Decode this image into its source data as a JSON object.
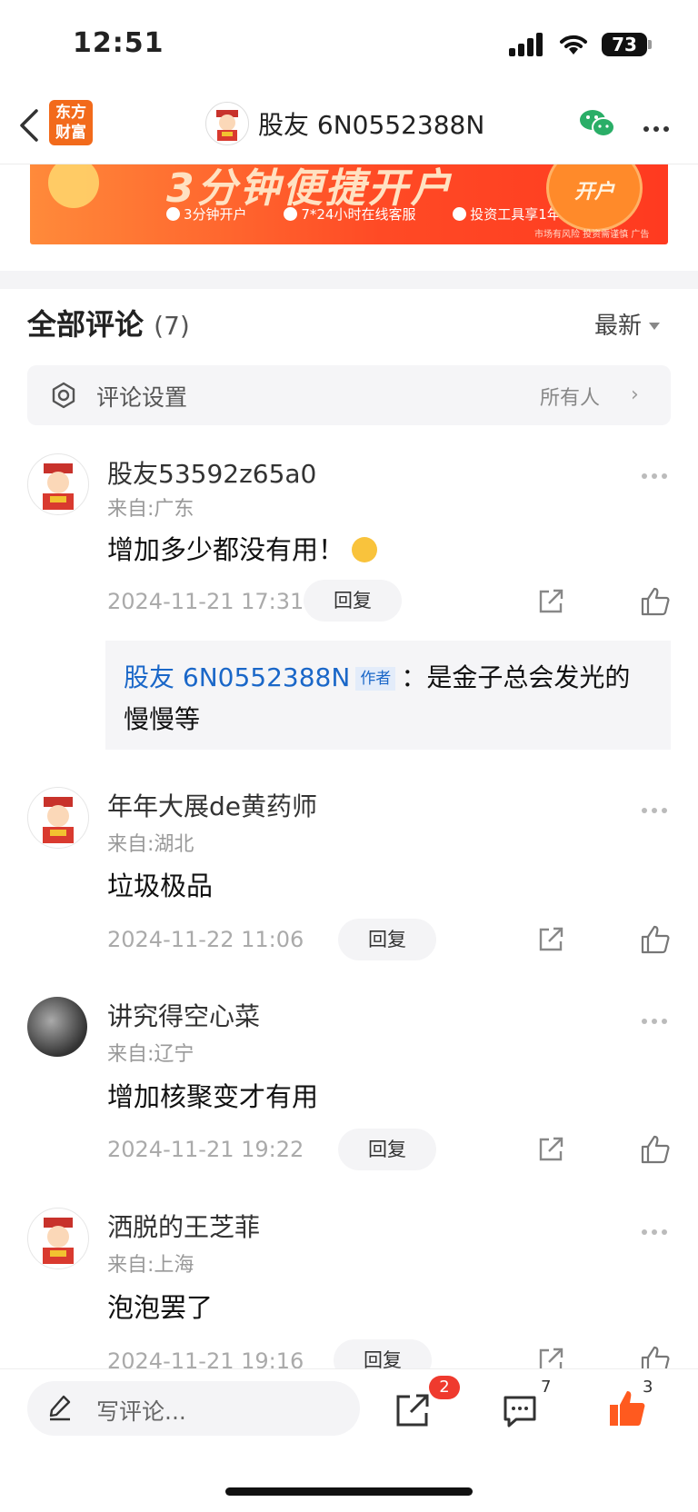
{
  "status": {
    "time": "12:51",
    "battery": "73"
  },
  "nav": {
    "logo_line1": "东方",
    "logo_line2": "财富",
    "title": "股友 6N0552388N"
  },
  "banner": {
    "title": "3分钟便捷开户",
    "features": [
      "3分钟开户",
      "7*24小时在线客服",
      "投资工具享1年"
    ],
    "button": "开户",
    "risk": "市场有风险 投资需谨慎 广告"
  },
  "comments_header": {
    "title": "全部评论",
    "count": "(7)",
    "sort": "最新"
  },
  "settings": {
    "label": "评论设置",
    "value": "所有人"
  },
  "comments": [
    {
      "user": "股友53592z65a0",
      "location": "来自:广东",
      "text": "增加多少都没有用！",
      "time": "2024-11-21 17:31",
      "reply_label": "回复"
    },
    {
      "user": "年年大展de黄药师",
      "location": "来自:湖北",
      "text": "垃圾极品",
      "time": "2024-11-22 11:06",
      "reply_label": "回复"
    },
    {
      "user": "讲究得空心菜",
      "location": "来自:辽宁",
      "text": "增加核聚变才有用",
      "time": "2024-11-21 19:22",
      "reply_label": "回复"
    },
    {
      "user": "洒脱的王芝菲",
      "location": "来自:上海",
      "text": "泡泡罢了",
      "time": "2024-11-21 19:16",
      "reply_label": "回复"
    }
  ],
  "author_reply": {
    "name": "股友 6N0552388N",
    "tag": "作者",
    "sep": "：",
    "text": "是金子总会发光的慢慢等"
  },
  "bottom": {
    "write_placeholder": "写评论...",
    "share_badge": "2",
    "comment_count": "7",
    "like_count": "3"
  },
  "colors": {
    "brand": "#f26a1b",
    "link": "#1a67c8",
    "badge": "#ef3a2e",
    "like": "#ff5a1f",
    "wechat": "#2aae67"
  }
}
